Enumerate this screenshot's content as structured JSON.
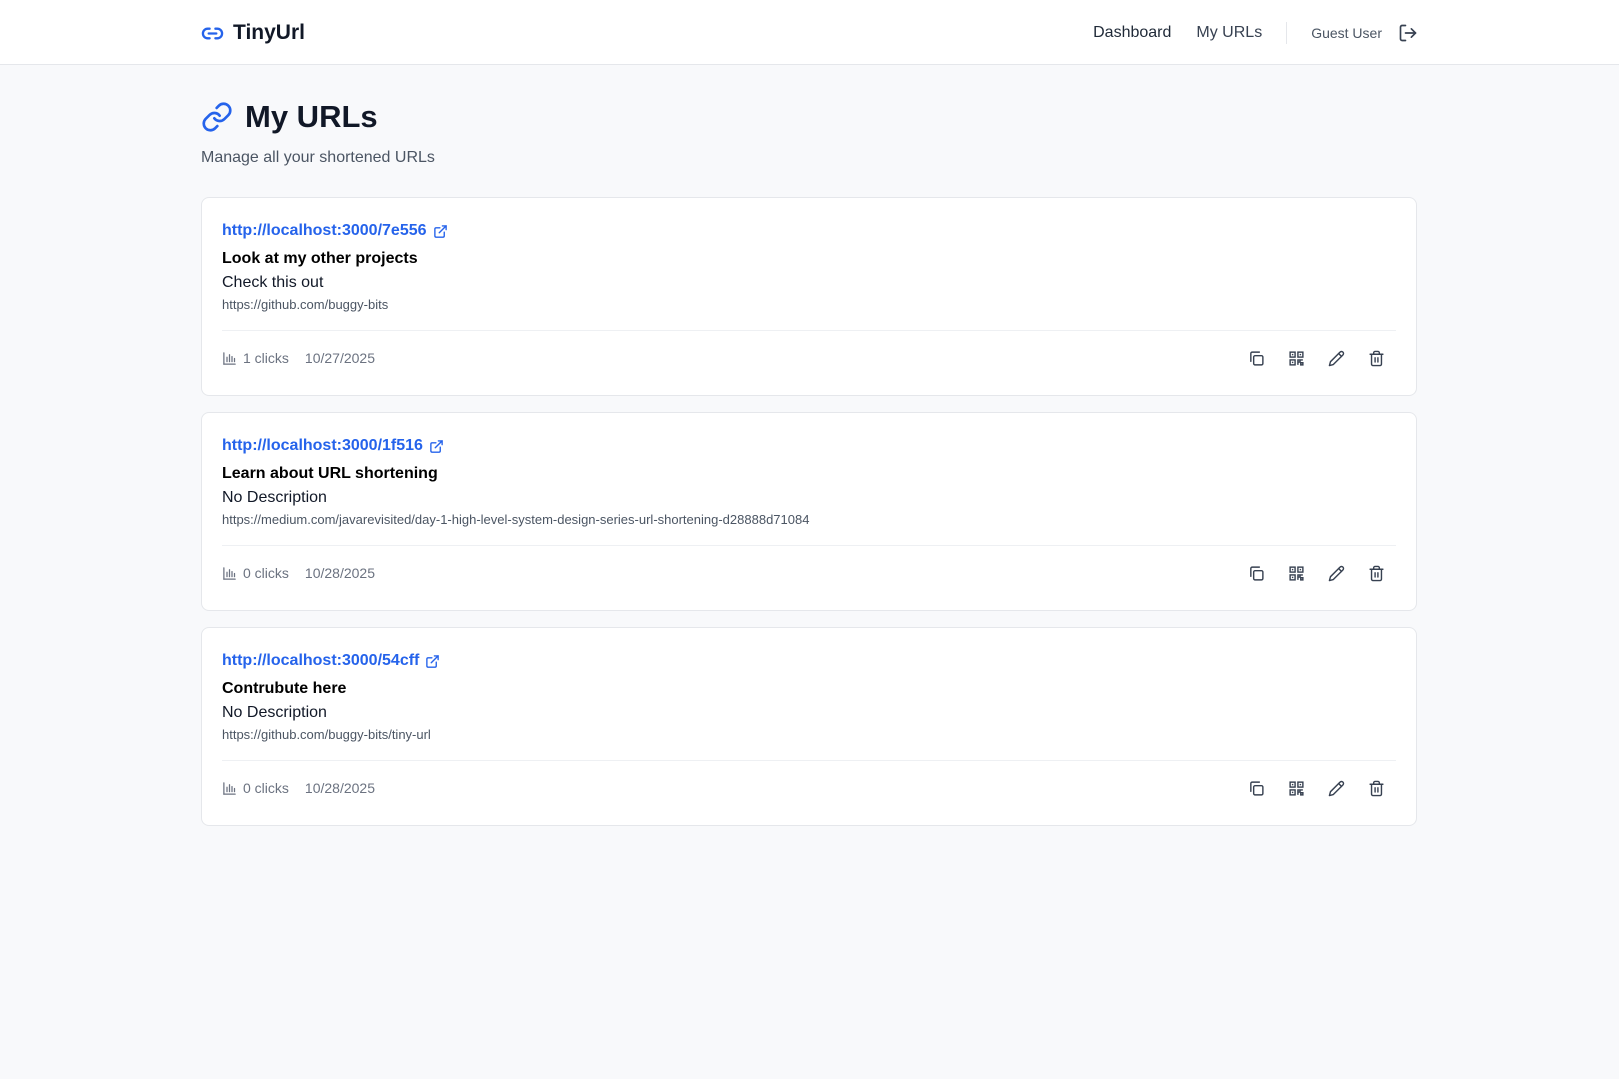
{
  "app": {
    "brand": "TinyUrl",
    "accent_color": "#2563eb"
  },
  "nav": {
    "links": [
      {
        "label": "Dashboard"
      },
      {
        "label": "My URLs"
      }
    ],
    "user_name": "Guest User",
    "logout_icon": "logout-icon"
  },
  "page": {
    "title": "My URLs",
    "subtitle": "Manage all your shortened URLs",
    "title_icon": "link-icon"
  },
  "urls": [
    {
      "short_url": "http://localhost:3000/7e556",
      "title": "Look at my other projects",
      "description": "Check this out",
      "original_url": "https://github.com/buggy-bits",
      "clicks": "1 clicks",
      "date": "10/27/2025"
    },
    {
      "short_url": "http://localhost:3000/1f516",
      "title": "Learn about URL shortening",
      "description": "No Description",
      "original_url": "https://medium.com/javarevisited/day-1-high-level-system-design-series-url-shortening-d28888d71084",
      "clicks": "0 clicks",
      "date": "10/28/2025"
    },
    {
      "short_url": "http://localhost:3000/54cff",
      "title": "Contrubute here",
      "description": "No Description",
      "original_url": "https://github.com/buggy-bits/tiny-url",
      "clicks": "0 clicks",
      "date": "10/28/2025"
    }
  ],
  "card_actions": [
    "copy-icon",
    "qr-code-icon",
    "edit-icon",
    "delete-icon"
  ]
}
